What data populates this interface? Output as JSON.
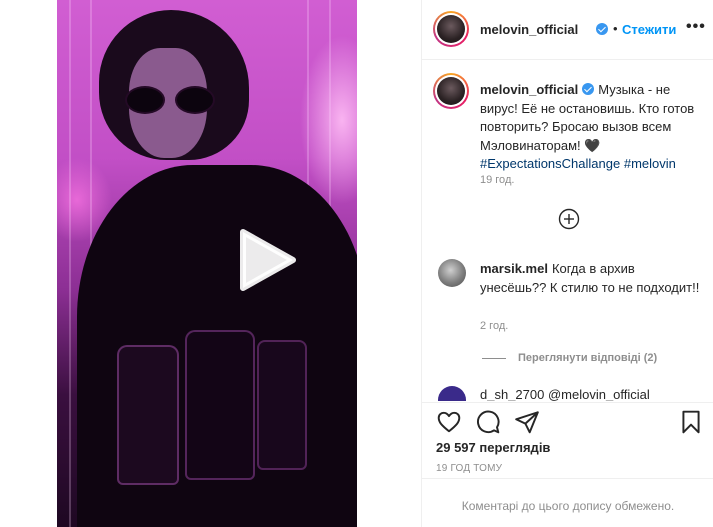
{
  "post": {
    "username": "melovin_official",
    "follow_label": "Стежити",
    "dot": "•",
    "more": "•••"
  },
  "caption": {
    "username": "melovin_official",
    "text": "Музыка - не вирус! Её не остановишь. Кто готов повторить? Бросаю вызов всем Мэловинаторам!",
    "heart": "🖤",
    "hashtags": [
      "#ExpectationsChallange",
      "#melovin"
    ],
    "time": "19 год."
  },
  "comment": {
    "username": "marsik.mel",
    "text": "Когда в архив унесёшь?? К стилю то не подходит!!",
    "time": "2 год.",
    "replies_label": "Переглянути відповіді (2)"
  },
  "next_comment": {
    "text": "d_sh_2700 @melovin_official"
  },
  "stats": {
    "views": "29 597 переглядів",
    "posted": "19 ГОД ТОМУ"
  },
  "footer": {
    "limited_text": "Коментарі до цього допису обмежено."
  },
  "icons": {
    "play": "play-icon",
    "add_comments": "plus-circle-icon",
    "like": "heart-icon",
    "comment": "comment-icon",
    "share": "share-icon",
    "save": "bookmark-icon"
  },
  "colors": {
    "follow": "#0095f6",
    "verified": "#3897f0",
    "hashtag": "#00376b",
    "muted": "#8e8e8e"
  }
}
